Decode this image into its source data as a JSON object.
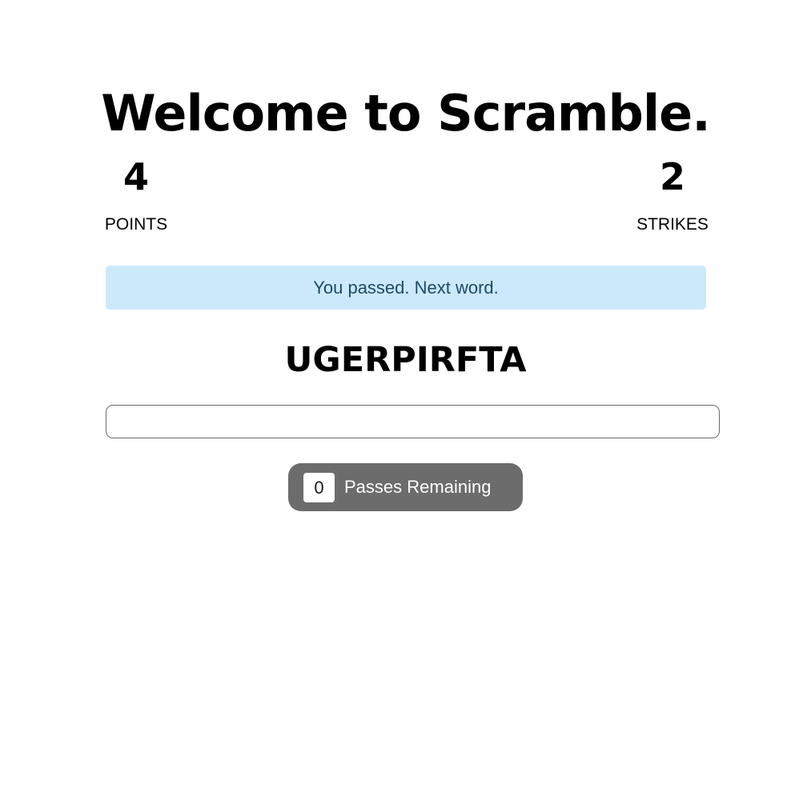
{
  "header": {
    "title": "Welcome to Scramble."
  },
  "stats": {
    "points": {
      "value": "4",
      "label": "POINTS"
    },
    "strikes": {
      "value": "2",
      "label": "STRIKES"
    }
  },
  "message": {
    "text": "You passed. Next word.",
    "background_color": "#cce9fc",
    "text_color": "#1e4a66"
  },
  "game": {
    "scrambled_word": "UGERPIRFTA",
    "guess_value": "",
    "guess_placeholder": ""
  },
  "passes": {
    "remaining": "0",
    "label": "Passes Remaining",
    "button_color": "#6c6c6c"
  }
}
